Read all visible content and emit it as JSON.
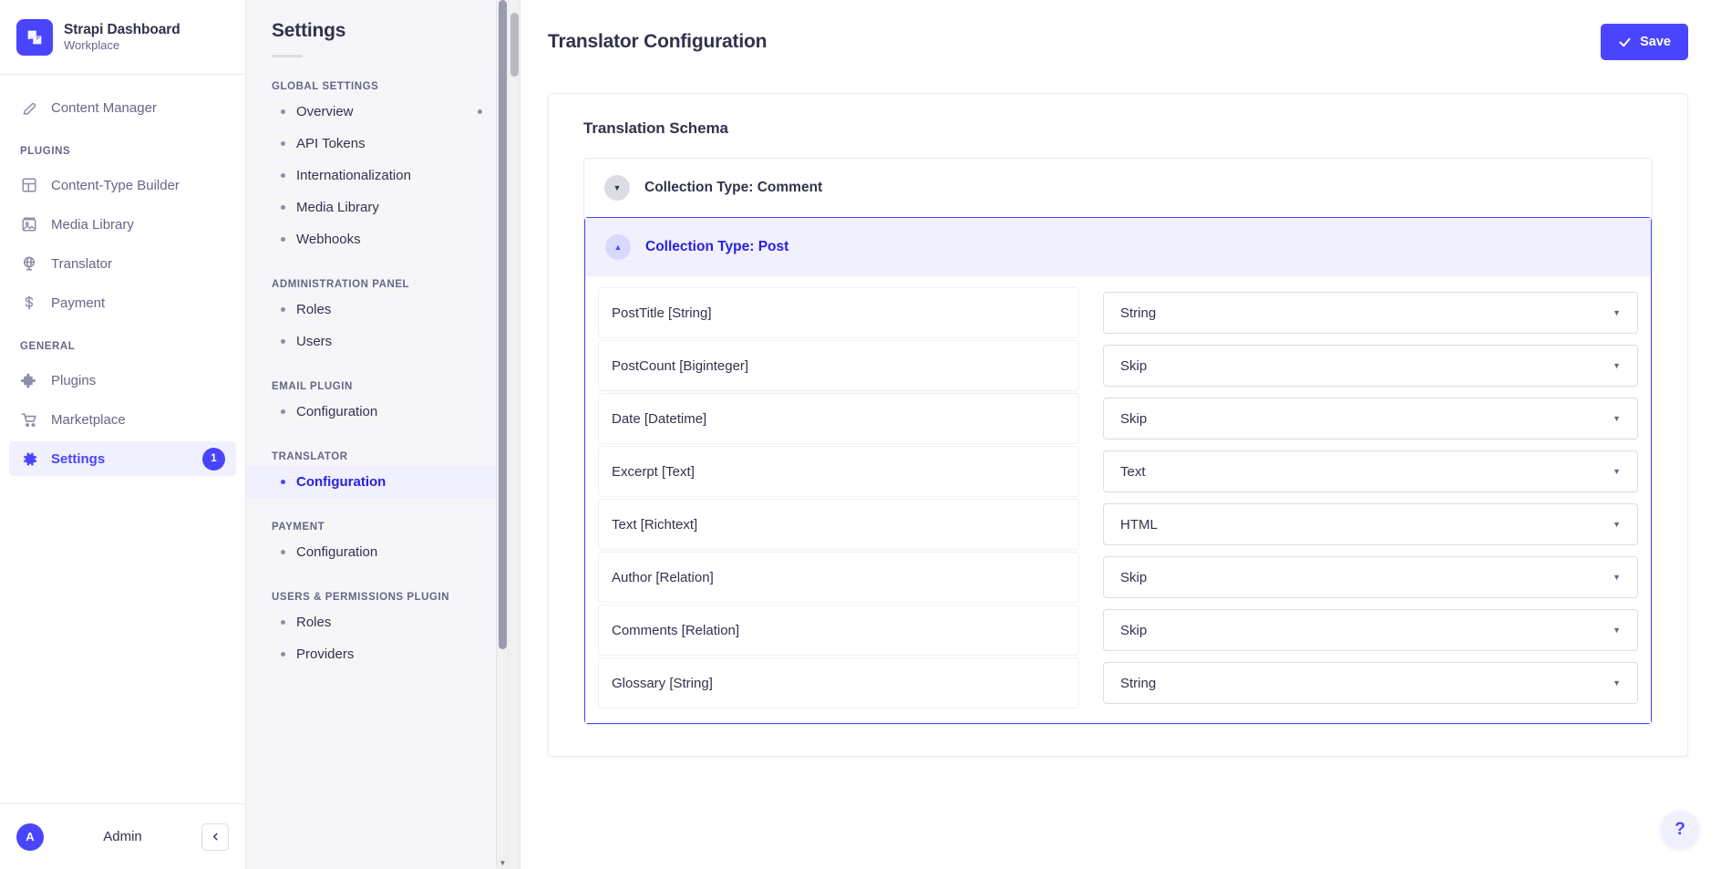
{
  "brand": {
    "title": "Strapi Dashboard",
    "subtitle": "Workplace",
    "logo_icon": "strapi-logo-icon",
    "logo_color": "#4945ff"
  },
  "sidebar": {
    "top_items": [
      {
        "label": "Content Manager",
        "icon": "pencil-icon",
        "active": false
      }
    ],
    "sections": [
      {
        "title": "PLUGINS",
        "items": [
          {
            "label": "Content-Type Builder",
            "icon": "layout-icon",
            "active": false
          },
          {
            "label": "Media Library",
            "icon": "image-icon",
            "active": false
          },
          {
            "label": "Translator",
            "icon": "globe-icon",
            "active": false
          },
          {
            "label": "Payment",
            "icon": "dollar-icon",
            "active": false
          }
        ]
      },
      {
        "title": "GENERAL",
        "items": [
          {
            "label": "Plugins",
            "icon": "puzzle-icon",
            "active": false
          },
          {
            "label": "Marketplace",
            "icon": "cart-icon",
            "active": false
          },
          {
            "label": "Settings",
            "icon": "gear-icon",
            "active": true,
            "badge": "1"
          }
        ]
      }
    ],
    "footer": {
      "avatar_initial": "A",
      "user_name": "Admin",
      "collapse_icon": "chevron-left-icon"
    }
  },
  "subnav": {
    "title": "Settings",
    "sections": [
      {
        "title": "GLOBAL SETTINGS",
        "items": [
          {
            "label": "Overview",
            "active": false,
            "trailing_dot": true
          },
          {
            "label": "API Tokens",
            "active": false
          },
          {
            "label": "Internationalization",
            "active": false
          },
          {
            "label": "Media Library",
            "active": false
          },
          {
            "label": "Webhooks",
            "active": false
          }
        ]
      },
      {
        "title": "ADMINISTRATION PANEL",
        "items": [
          {
            "label": "Roles",
            "active": false
          },
          {
            "label": "Users",
            "active": false
          }
        ]
      },
      {
        "title": "EMAIL PLUGIN",
        "items": [
          {
            "label": "Configuration",
            "active": false
          }
        ]
      },
      {
        "title": "TRANSLATOR",
        "items": [
          {
            "label": "Configuration",
            "active": true
          }
        ]
      },
      {
        "title": "PAYMENT",
        "items": [
          {
            "label": "Configuration",
            "active": false
          }
        ]
      },
      {
        "title": "USERS & PERMISSIONS PLUGIN",
        "items": [
          {
            "label": "Roles",
            "active": false
          },
          {
            "label": "Providers",
            "active": false
          }
        ]
      }
    ]
  },
  "header": {
    "page_title": "Translator Configuration",
    "save_label": "Save",
    "save_icon": "check-icon",
    "save_color": "#4945ff"
  },
  "card": {
    "title": "Translation Schema",
    "accordions": [
      {
        "label": "Collection Type: Comment",
        "expanded": false,
        "toggle_icon": "chevron-down-icon",
        "fields": []
      },
      {
        "label": "Collection Type: Post",
        "expanded": true,
        "toggle_icon": "chevron-up-icon",
        "fields": [
          {
            "name": "PostTitle [String]",
            "value": "String"
          },
          {
            "name": "PostCount [Biginteger]",
            "value": "Skip"
          },
          {
            "name": "Date [Datetime]",
            "value": "Skip"
          },
          {
            "name": "Excerpt [Text]",
            "value": "Text"
          },
          {
            "name": "Text [Richtext]",
            "value": "HTML"
          },
          {
            "name": "Author [Relation]",
            "value": "Skip"
          },
          {
            "name": "Comments [Relation]",
            "value": "Skip"
          },
          {
            "name": "Glossary [String]",
            "value": "String"
          }
        ]
      }
    ]
  },
  "help": {
    "label": "?",
    "icon": "question-mark-icon"
  }
}
